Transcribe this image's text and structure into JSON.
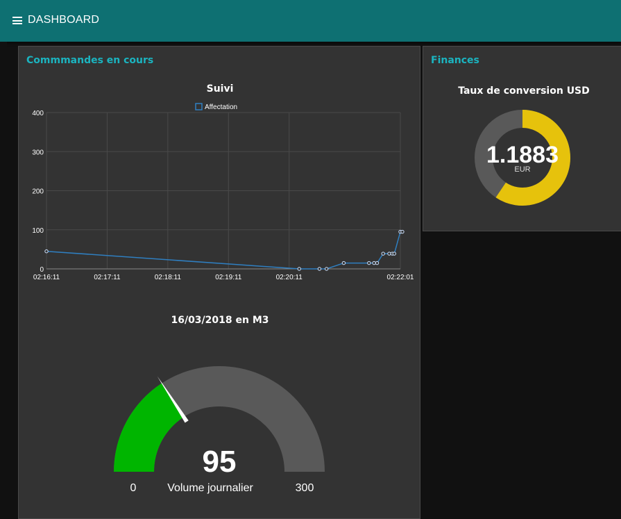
{
  "header": {
    "menu_icon": "hamburger-menu-icon",
    "title": "DASHBOARD",
    "color": "#0e7072"
  },
  "groups": [
    {
      "title": "Commmandes en cours",
      "widgets": {
        "line_chart_title": "Suivi",
        "gauge_title": "16/03/2018 en M3"
      }
    },
    {
      "title": "Finances",
      "widgets": {
        "donut_title": "Taux de conversion USD"
      }
    }
  ],
  "colors": {
    "accent": "#1bb4c0",
    "line": "#2f7fc1",
    "gauge_fill": "#00b500",
    "donut_fill": "#e6c20c",
    "track": "#595959",
    "card": "#333333"
  },
  "chart_data": [
    {
      "type": "line",
      "title": "Suivi",
      "series": [
        {
          "name": "Affectation",
          "x": [
            "02:16:11",
            "02:20:21",
            "02:20:41",
            "02:20:48",
            "02:21:05",
            "02:21:30",
            "02:21:35",
            "02:21:38",
            "02:21:44",
            "02:21:50",
            "02:21:53",
            "02:21:55",
            "02:22:01",
            "02:22:03"
          ],
          "values": [
            45,
            0,
            0,
            0,
            15,
            15,
            15,
            15,
            39,
            39,
            39,
            39,
            95,
            95
          ]
        }
      ],
      "x_ticks": [
        "02:16:11",
        "02:17:11",
        "02:18:11",
        "02:19:11",
        "02:20:11",
        "02:22:01"
      ],
      "y_ticks": [
        "0",
        "100",
        "200",
        "300",
        "400"
      ],
      "ylim": [
        0,
        400
      ],
      "grid": true,
      "legend": "top-center"
    },
    {
      "type": "gauge",
      "title": "16/03/2018 en M3",
      "value": 95,
      "value_label": "95",
      "min": 0,
      "max": 300,
      "min_label": "0",
      "max_label": "300",
      "label": "Volume journalier"
    },
    {
      "type": "donut",
      "title": "Taux de conversion USD",
      "value": 1.1883,
      "value_label": "1.1883",
      "unit": "EUR",
      "min": 0,
      "max": 2
    }
  ]
}
